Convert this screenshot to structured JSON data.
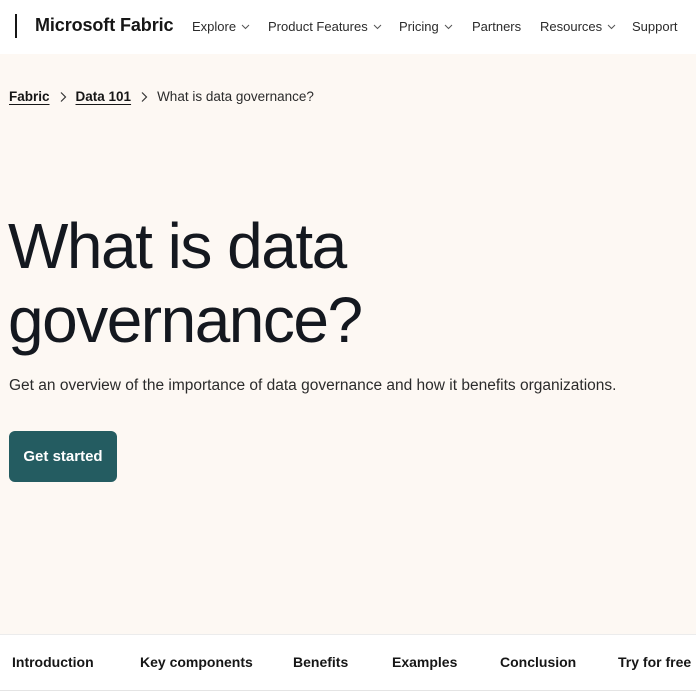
{
  "header": {
    "brand": "Microsoft Fabric",
    "menu": [
      {
        "label": "Explore",
        "has_dropdown": true
      },
      {
        "label": "Product Features",
        "has_dropdown": true
      },
      {
        "label": "Pricing",
        "has_dropdown": true
      },
      {
        "label": "Partners",
        "has_dropdown": false
      },
      {
        "label": "Resources",
        "has_dropdown": true
      },
      {
        "label": "Support",
        "has_dropdown": false
      }
    ]
  },
  "breadcrumb": {
    "items": [
      {
        "label": "Fabric"
      },
      {
        "label": "Data 101"
      }
    ],
    "current": "What is data governance?"
  },
  "hero": {
    "title_line1": "What is data",
    "title_line2": "governance?",
    "subtitle": "Get an overview of the importance of data governance and how it benefits organizations.",
    "cta_label": "Get started"
  },
  "section_tabs": [
    {
      "label": "Introduction"
    },
    {
      "label": "Key components"
    },
    {
      "label": "Benefits"
    },
    {
      "label": "Examples"
    },
    {
      "label": "Conclusion"
    },
    {
      "label": "Try for free"
    }
  ],
  "colors": {
    "hero_bg": "#fdf8f3",
    "cta_bg": "#245c61",
    "text": "#161616"
  },
  "icons": {
    "dropdown": "chevron-down-icon",
    "breadcrumb_separator": "chevron-right-icon"
  }
}
